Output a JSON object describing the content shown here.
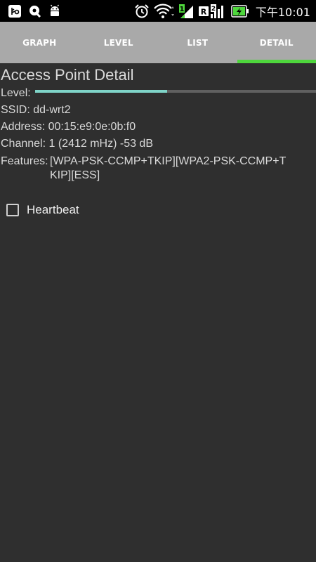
{
  "status_bar": {
    "time": "下午10:01",
    "icons_left": [
      "usb-debug-icon",
      "vpn-key-icon",
      "android-icon"
    ],
    "icons_right": [
      "alarm-icon",
      "wifi-icon",
      "mobile-signal-1-icon",
      "roaming-signal-2-icon",
      "battery-charging-icon"
    ],
    "signal_1_label": "1",
    "signal_2_label": "R",
    "signal_2_sub": "2"
  },
  "tabs": [
    {
      "label": "GRAPH",
      "active": false
    },
    {
      "label": "LEVEL",
      "active": false
    },
    {
      "label": "LIST",
      "active": false
    },
    {
      "label": "DETAIL",
      "active": true
    }
  ],
  "detail": {
    "title": "Access Point Detail",
    "level_label": "Level:",
    "level_fraction": 0.47,
    "ssid": "SSID: dd-wrt2",
    "address": "Address: 00:15:e9:0e:0b:f0",
    "channel": "Channel: 1 (2412 mHz) -53 dB",
    "features_label": "Features:",
    "features_value": "[WPA-PSK-CCMP+TKIP][WPA2-PSK-CCMP+TKIP][ESS]",
    "heartbeat_label": "Heartbeat",
    "heartbeat_checked": false
  },
  "colors": {
    "status_bar": "#000000",
    "tab_bar": "#a9a9a9",
    "tab_indicator": "#4ed63c",
    "background": "#2f2f2f",
    "level_fill": "#7fd4c8",
    "level_track": "#606060"
  }
}
